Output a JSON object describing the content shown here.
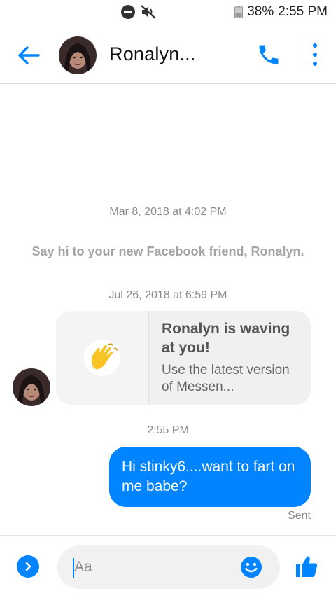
{
  "status_bar": {
    "battery_percent": "38%",
    "time": "2:55 PM",
    "icons": [
      "do-not-disturb-icon",
      "mute-icon",
      "battery-icon"
    ]
  },
  "header": {
    "contact_name": "Ronalyn...",
    "icons": [
      "back-arrow-icon",
      "phone-icon",
      "more-vertical-icon"
    ],
    "accent_color": "#0084ff"
  },
  "messages": {
    "timestamp_1": "Mar 8, 2018 at 4:02 PM",
    "system_text": "Say hi to your new Facebook friend, Ronalyn.",
    "timestamp_2": "Jul 26, 2018 at 6:59 PM",
    "wave_card": {
      "title": "Ronalyn is waving at you!",
      "subtitle": "Use the latest version of Messen...",
      "icon": "waving-hand-icon"
    },
    "timestamp_3": "2:55 PM",
    "outgoing_text": "Hi stinky6....want to fart on me babe?",
    "outgoing_color": "#0084ff",
    "sent_status": "Sent"
  },
  "composer": {
    "placeholder": "Aa",
    "icons": [
      "expand-chevron-icon",
      "emoji-icon",
      "thumbs-up-icon"
    ]
  }
}
